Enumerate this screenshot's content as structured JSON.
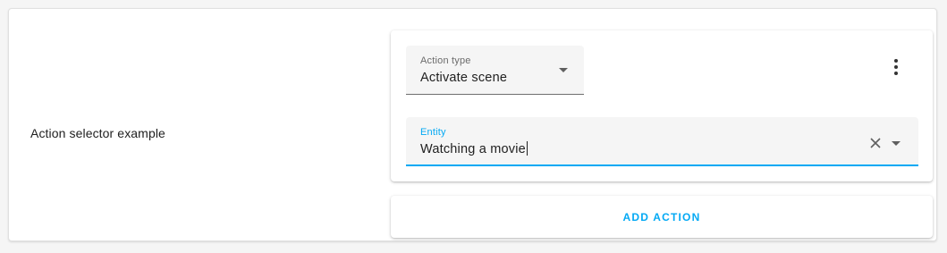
{
  "row": {
    "label": "Action selector example"
  },
  "action": {
    "type_field": {
      "label": "Action type",
      "value": "Activate scene"
    },
    "entity_field": {
      "label": "Entity",
      "value": "Watching a movie"
    },
    "more_icon": "dots-vertical-icon",
    "clear_icon": "close-icon",
    "dropdown_icon": "menu-down-icon"
  },
  "add_action": {
    "label": "ADD ACTION"
  },
  "colors": {
    "accent": "#03a9f4",
    "field_background": "#f5f5f5",
    "text": "#212121"
  }
}
